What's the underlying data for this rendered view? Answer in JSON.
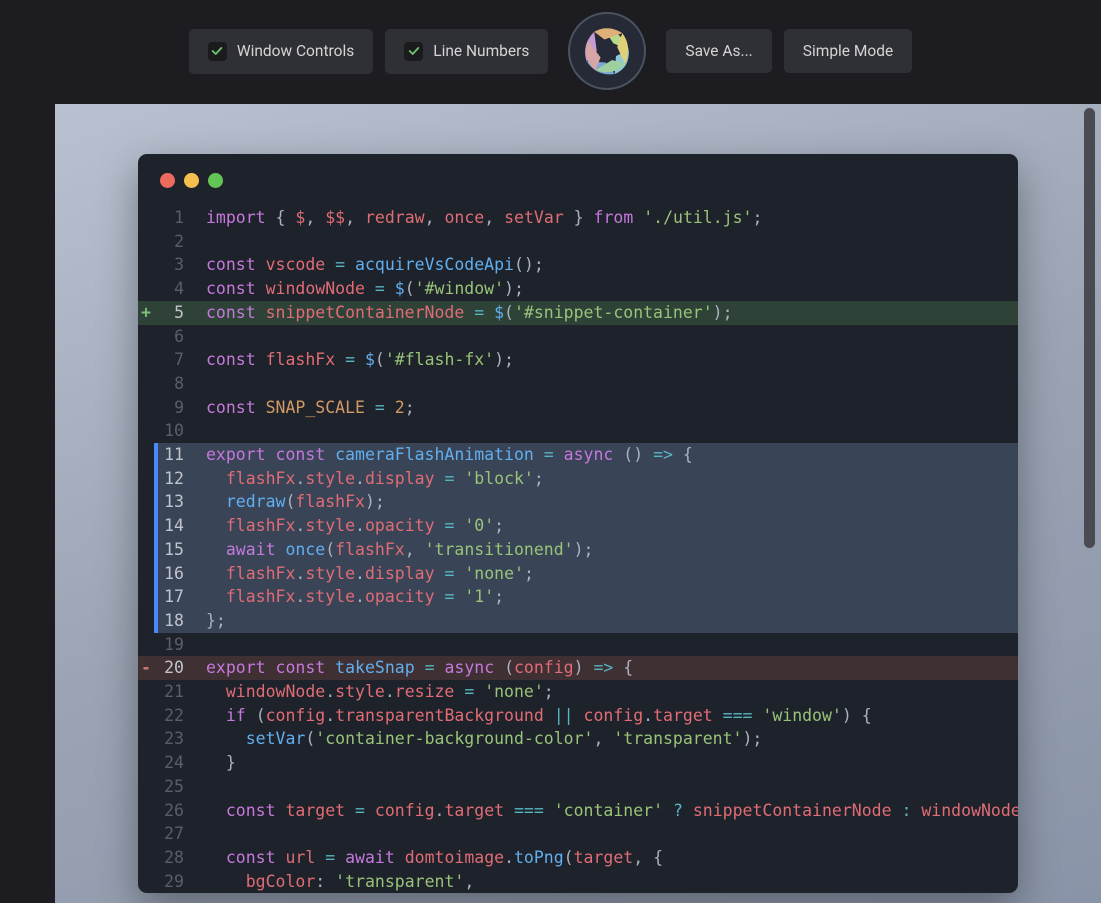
{
  "toolbar": {
    "window_controls": {
      "label": "Window Controls",
      "checked": true
    },
    "line_numbers": {
      "label": "Line Numbers",
      "checked": true
    },
    "save_as": "Save As...",
    "simple_mode": "Simple Mode"
  },
  "traffic_lights": [
    "red",
    "yellow",
    "green"
  ],
  "code": {
    "lines": [
      {
        "n": 1,
        "diff": "",
        "style": "",
        "html": "<span class='kw'>import</span> <span class='pn'>{</span> <span class='id'>$</span><span class='pn'>,</span> <span class='id'>$$</span><span class='pn'>,</span> <span class='id'>redraw</span><span class='pn'>,</span> <span class='id'>once</span><span class='pn'>,</span> <span class='id'>setVar</span> <span class='pn'>}</span> <span class='kw'>from</span> <span class='str'>'./util.js'</span><span class='pn'>;</span>"
      },
      {
        "n": 2,
        "diff": "",
        "style": "",
        "html": ""
      },
      {
        "n": 3,
        "diff": "",
        "style": "",
        "html": "<span class='kw'>const</span> <span class='id'>vscode</span> <span class='op'>=</span> <span class='fn'>acquireVsCodeApi</span><span class='pn'>();</span>"
      },
      {
        "n": 4,
        "diff": "",
        "style": "",
        "html": "<span class='kw'>const</span> <span class='id'>windowNode</span> <span class='op'>=</span> <span class='fn'>$</span><span class='pn'>(</span><span class='str'>'#window'</span><span class='pn'>);</span>"
      },
      {
        "n": 5,
        "diff": "+",
        "style": "added",
        "html": "<span class='kw'>const</span> <span class='id'>snippetContainerNode</span> <span class='op'>=</span> <span class='fn'>$</span><span class='pn'>(</span><span class='str'>'#snippet-container'</span><span class='pn'>);</span>"
      },
      {
        "n": 6,
        "diff": "",
        "style": "",
        "html": ""
      },
      {
        "n": 7,
        "diff": "",
        "style": "",
        "html": "<span class='kw'>const</span> <span class='id'>flashFx</span> <span class='op'>=</span> <span class='fn'>$</span><span class='pn'>(</span><span class='str'>'#flash-fx'</span><span class='pn'>);</span>"
      },
      {
        "n": 8,
        "diff": "",
        "style": "",
        "html": ""
      },
      {
        "n": 9,
        "diff": "",
        "style": "",
        "html": "<span class='kw'>const</span> <span class='id2'>SNAP_SCALE</span> <span class='op'>=</span> <span class='num'>2</span><span class='pn'>;</span>"
      },
      {
        "n": 10,
        "diff": "",
        "style": "",
        "html": ""
      },
      {
        "n": 11,
        "diff": "",
        "style": "selected",
        "html": "<span class='kw'>export</span> <span class='kw'>const</span> <span class='fn'>cameraFlashAnimation</span> <span class='op'>=</span> <span class='kw'>async</span> <span class='pn'>()</span> <span class='op'>=&gt;</span> <span class='pn'>{</span>"
      },
      {
        "n": 12,
        "diff": "",
        "style": "selected",
        "html": "  <span class='id'>flashFx</span><span class='pn'>.</span><span class='id'>style</span><span class='pn'>.</span><span class='id'>display</span> <span class='op'>=</span> <span class='str'>'block'</span><span class='pn'>;</span>"
      },
      {
        "n": 13,
        "diff": "",
        "style": "selected",
        "html": "  <span class='fn'>redraw</span><span class='pn'>(</span><span class='id'>flashFx</span><span class='pn'>);</span>"
      },
      {
        "n": 14,
        "diff": "",
        "style": "selected",
        "html": "  <span class='id'>flashFx</span><span class='pn'>.</span><span class='id'>style</span><span class='pn'>.</span><span class='id'>opacity</span> <span class='op'>=</span> <span class='str'>'0'</span><span class='pn'>;</span>"
      },
      {
        "n": 15,
        "diff": "",
        "style": "selected",
        "html": "  <span class='kw'>await</span> <span class='fn'>once</span><span class='pn'>(</span><span class='id'>flashFx</span><span class='pn'>,</span> <span class='str'>'transitionend'</span><span class='pn'>);</span>"
      },
      {
        "n": 16,
        "diff": "",
        "style": "selected",
        "html": "  <span class='id'>flashFx</span><span class='pn'>.</span><span class='id'>style</span><span class='pn'>.</span><span class='id'>display</span> <span class='op'>=</span> <span class='str'>'none'</span><span class='pn'>;</span>"
      },
      {
        "n": 17,
        "diff": "",
        "style": "selected",
        "html": "  <span class='id'>flashFx</span><span class='pn'>.</span><span class='id'>style</span><span class='pn'>.</span><span class='id'>opacity</span> <span class='op'>=</span> <span class='str'>'1'</span><span class='pn'>;</span>"
      },
      {
        "n": 18,
        "diff": "",
        "style": "selected",
        "html": "<span class='pn'>};</span>"
      },
      {
        "n": 19,
        "diff": "",
        "style": "",
        "html": ""
      },
      {
        "n": 20,
        "diff": "-",
        "style": "removed",
        "html": "<span class='kw'>export</span> <span class='kw'>const</span> <span class='fn'>takeSnap</span> <span class='op'>=</span> <span class='kw'>async</span> <span class='pn'>(</span><span class='id'>config</span><span class='pn'>)</span> <span class='op'>=&gt;</span> <span class='pn'>{</span>"
      },
      {
        "n": 21,
        "diff": "",
        "style": "",
        "html": "  <span class='id'>windowNode</span><span class='pn'>.</span><span class='id'>style</span><span class='pn'>.</span><span class='id'>resize</span> <span class='op'>=</span> <span class='str'>'none'</span><span class='pn'>;</span>"
      },
      {
        "n": 22,
        "diff": "",
        "style": "",
        "html": "  <span class='kw'>if</span> <span class='pn'>(</span><span class='id'>config</span><span class='pn'>.</span><span class='id'>transparentBackground</span> <span class='op'>||</span> <span class='id'>config</span><span class='pn'>.</span><span class='id'>target</span> <span class='op'>===</span> <span class='str'>'window'</span><span class='pn'>)</span> <span class='pn'>{</span>"
      },
      {
        "n": 23,
        "diff": "",
        "style": "",
        "html": "    <span class='fn'>setVar</span><span class='pn'>(</span><span class='str'>'container-background-color'</span><span class='pn'>,</span> <span class='str'>'transparent'</span><span class='pn'>);</span>"
      },
      {
        "n": 24,
        "diff": "",
        "style": "",
        "html": "  <span class='pn'>}</span>"
      },
      {
        "n": 25,
        "diff": "",
        "style": "",
        "html": ""
      },
      {
        "n": 26,
        "diff": "",
        "style": "",
        "html": "  <span class='kw'>const</span> <span class='id'>target</span> <span class='op'>=</span> <span class='id'>config</span><span class='pn'>.</span><span class='id'>target</span> <span class='op'>===</span> <span class='str'>'container'</span> <span class='op'>?</span> <span class='id'>snippetContainerNode</span> <span class='op'>:</span> <span class='id'>windowNode</span><span class='pn'>;</span>"
      },
      {
        "n": 27,
        "diff": "",
        "style": "",
        "html": ""
      },
      {
        "n": 28,
        "diff": "",
        "style": "",
        "html": "  <span class='kw'>const</span> <span class='id'>url</span> <span class='op'>=</span> <span class='kw'>await</span> <span class='id'>domtoimage</span><span class='pn'>.</span><span class='fn'>toPng</span><span class='pn'>(</span><span class='id'>target</span><span class='pn'>,</span> <span class='pn'>{</span>"
      },
      {
        "n": 29,
        "diff": "",
        "style": "",
        "html": "    <span class='id'>bgColor</span><span class='pn'>:</span> <span class='str'>'transparent'</span><span class='pn'>,</span>"
      }
    ]
  }
}
